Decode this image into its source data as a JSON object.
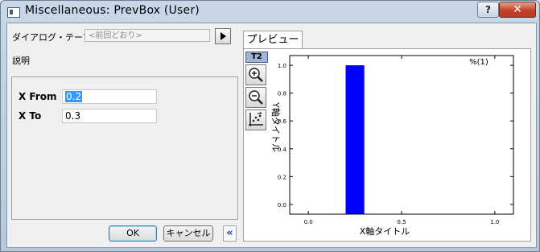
{
  "window": {
    "title": "Miscellaneous: PrevBox (User)",
    "help_label": "?",
    "close_label": "✕"
  },
  "dialog_theme": {
    "label": "ダイアログ・テーマ(H)",
    "value": "<前回どおり>"
  },
  "description_label": "説明",
  "params": [
    {
      "label": "X From",
      "value": "0.2",
      "selected": true
    },
    {
      "label": "X To",
      "value": "0.3",
      "selected": false
    }
  ],
  "buttons": {
    "ok": "OK",
    "cancel": "キャンセル",
    "collapse": "«"
  },
  "preview": {
    "tab_label": "プレビュー",
    "layer_tag": "T2",
    "tools": [
      "zoom-in-icon",
      "zoom-out-icon",
      "rescale-icon"
    ]
  },
  "chart_data": {
    "type": "bar",
    "title": "",
    "xlabel": "X軸タイトル",
    "ylabel": "Y軸タイトル",
    "xlim": [
      -0.1,
      1.1
    ],
    "ylim": [
      -0.07,
      1.07
    ],
    "x_ticks": [
      0.0,
      0.5,
      1.0
    ],
    "x_tick_labels": [
      "0.0",
      "0.5",
      "1.0"
    ],
    "y_ticks": [
      0.0,
      0.2,
      0.4,
      0.6,
      0.8,
      1.0
    ],
    "y_tick_labels": [
      "0.0",
      "0.2",
      "0.4",
      "0.6",
      "0.8",
      "1.0"
    ],
    "bars": [
      {
        "x_from": 0.2,
        "x_to": 0.3,
        "value": 1.0
      }
    ],
    "bar_color": "#0000ff",
    "legend": "%(1)",
    "legend_position": "top-right",
    "grid": false
  }
}
